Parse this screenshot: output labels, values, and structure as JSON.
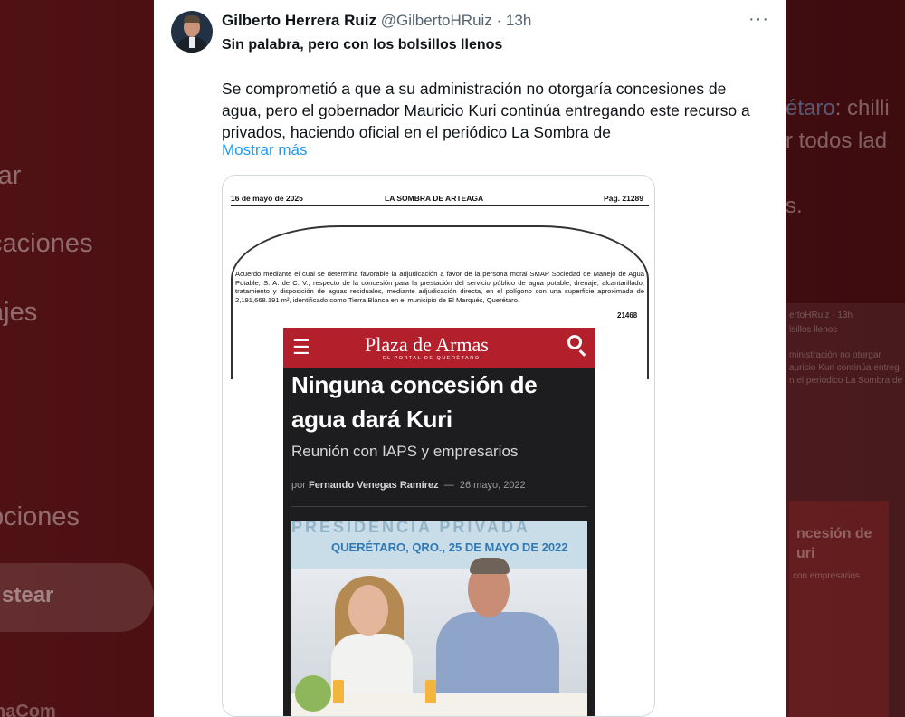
{
  "background": {
    "left_nav": [
      "rar",
      "caciones",
      "ajes",
      "pciones"
    ],
    "left_button": "stear",
    "left_user": "naCom",
    "right_lines": [
      {
        "text": "étaro",
        "link": true,
        "rest": ": chilli"
      },
      {
        "text": "r todos lad",
        "link": false,
        "rest": ""
      },
      {
        "text": "s.",
        "link": false,
        "rest": ""
      }
    ],
    "right_small": [
      "ertoHRuiz · 13h",
      "lsillos llenos",
      "ministración no otorgar",
      "auricio Kuri continúa entreg",
      "n el periódico La Sombra de",
      "ncesión de",
      "uri",
      "con empresarios"
    ]
  },
  "tweet": {
    "author_name": "Gilberto Herrera Ruiz",
    "author_handle": "@GilbertoHRuiz",
    "time": "· 13h",
    "more_label": "···",
    "lead": "Sin palabra, pero con los bolsillos llenos",
    "body": "Se comprometió a que a su administración no otorgaría concesiones de agua, pero el gobernador Mauricio Kuri continúa entregando este recurso a privados, haciendo oficial en el periódico La Sombra de",
    "show_more": "Mostrar más"
  },
  "gazette": {
    "date": "16 de mayo de 2025",
    "title": "LA SOMBRA DE ARTEAGA",
    "page": "Pág. 21289",
    "text": "Acuerdo mediante el cual se determina favorable la adjudicación a favor de la persona moral SMAP Sociedad de Manejo de Agua Potable, S. A. de C. V., respecto de la concesión para la prestación del servicio público de agua potable, drenaje, alcantarillado, tratamiento y disposición de aguas residuales, mediante adjudicación directa, en el polígono con una superficie aproximada de 2,191,668.191 m², identificado como Tierra Blanca en el municipio de El Marqués, Querétaro.",
    "number": "21468"
  },
  "article": {
    "site_name": "Plaza de Armas",
    "site_tagline": "EL PORTAL DE QUERÉTARO",
    "headline": "Ninguna concesión de agua dará Kuri",
    "subheadline": "Reunión con IAPS y empresarios",
    "by_prefix": "por",
    "author": "Fernando Venegas Ramírez",
    "separator": "—",
    "date": "26 mayo, 2022",
    "photo_banner_top": "PRESIDENCIA PRIVADA",
    "photo_caption": "QUERÉTARO, QRO., 25 DE MAYO DE 2022"
  },
  "colors": {
    "link": "#1d9bf0",
    "site_red": "#b3202c",
    "background": "#4a0f12"
  }
}
